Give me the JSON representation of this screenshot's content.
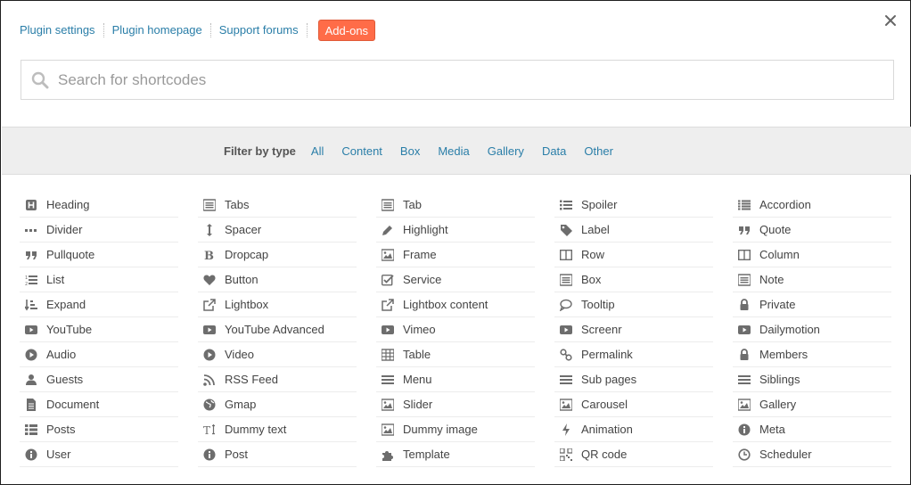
{
  "top_links": {
    "plugin_settings": "Plugin settings",
    "plugin_homepage": "Plugin homepage",
    "support_forums": "Support forums",
    "addons": "Add-ons"
  },
  "close_icon": "close-icon",
  "search": {
    "placeholder": "Search for shortcodes",
    "value": "",
    "icon": "search-icon"
  },
  "filter": {
    "label": "Filter by type",
    "types": [
      "All",
      "Content",
      "Box",
      "Media",
      "Gallery",
      "Data",
      "Other"
    ]
  },
  "shortcodes": [
    [
      {
        "label": "Heading",
        "icon": "heading"
      },
      {
        "label": "Divider",
        "icon": "ellipsis"
      },
      {
        "label": "Pullquote",
        "icon": "quote"
      },
      {
        "label": "List",
        "icon": "list-ol"
      },
      {
        "label": "Expand",
        "icon": "sort"
      },
      {
        "label": "YouTube",
        "icon": "youtube"
      },
      {
        "label": "Audio",
        "icon": "play-circle"
      },
      {
        "label": "Guests",
        "icon": "user"
      },
      {
        "label": "Document",
        "icon": "file"
      },
      {
        "label": "Posts",
        "icon": "th-list"
      },
      {
        "label": "User",
        "icon": "info"
      }
    ],
    [
      {
        "label": "Tabs",
        "icon": "list-alt"
      },
      {
        "label": "Spacer",
        "icon": "arrows-v"
      },
      {
        "label": "Dropcap",
        "icon": "bold"
      },
      {
        "label": "Button",
        "icon": "heart"
      },
      {
        "label": "Lightbox",
        "icon": "external-link"
      },
      {
        "label": "YouTube Advanced",
        "icon": "youtube"
      },
      {
        "label": "Video",
        "icon": "play-circle"
      },
      {
        "label": "RSS Feed",
        "icon": "rss"
      },
      {
        "label": "Gmap",
        "icon": "globe"
      },
      {
        "label": "Dummy text",
        "icon": "text-height"
      },
      {
        "label": "Post",
        "icon": "info"
      }
    ],
    [
      {
        "label": "Tab",
        "icon": "list-alt"
      },
      {
        "label": "Highlight",
        "icon": "pencil"
      },
      {
        "label": "Frame",
        "icon": "picture"
      },
      {
        "label": "Service",
        "icon": "check-square"
      },
      {
        "label": "Lightbox content",
        "icon": "external-link"
      },
      {
        "label": "Vimeo",
        "icon": "youtube"
      },
      {
        "label": "Table",
        "icon": "table"
      },
      {
        "label": "Menu",
        "icon": "bars"
      },
      {
        "label": "Slider",
        "icon": "picture"
      },
      {
        "label": "Dummy image",
        "icon": "picture"
      },
      {
        "label": "Template",
        "icon": "puzzle"
      }
    ],
    [
      {
        "label": "Spoiler",
        "icon": "list-ul"
      },
      {
        "label": "Label",
        "icon": "tag"
      },
      {
        "label": "Row",
        "icon": "columns"
      },
      {
        "label": "Box",
        "icon": "list-alt"
      },
      {
        "label": "Tooltip",
        "icon": "comment"
      },
      {
        "label": "Screenr",
        "icon": "youtube"
      },
      {
        "label": "Permalink",
        "icon": "link"
      },
      {
        "label": "Sub pages",
        "icon": "bars"
      },
      {
        "label": "Carousel",
        "icon": "picture"
      },
      {
        "label": "Animation",
        "icon": "bolt"
      },
      {
        "label": "QR code",
        "icon": "qrcode"
      }
    ],
    [
      {
        "label": "Accordion",
        "icon": "list"
      },
      {
        "label": "Quote",
        "icon": "quote"
      },
      {
        "label": "Column",
        "icon": "columns"
      },
      {
        "label": "Note",
        "icon": "list-alt"
      },
      {
        "label": "Private",
        "icon": "lock"
      },
      {
        "label": "Dailymotion",
        "icon": "youtube"
      },
      {
        "label": "Members",
        "icon": "lock"
      },
      {
        "label": "Siblings",
        "icon": "bars"
      },
      {
        "label": "Gallery",
        "icon": "picture"
      },
      {
        "label": "Meta",
        "icon": "info"
      },
      {
        "label": "Scheduler",
        "icon": "clock"
      }
    ]
  ],
  "colors": {
    "link": "#2a7ea8",
    "addons_bg": "#ff6c48",
    "filter_bg": "#eeeeee",
    "icon": "#6d6d6d",
    "text": "#444444"
  }
}
